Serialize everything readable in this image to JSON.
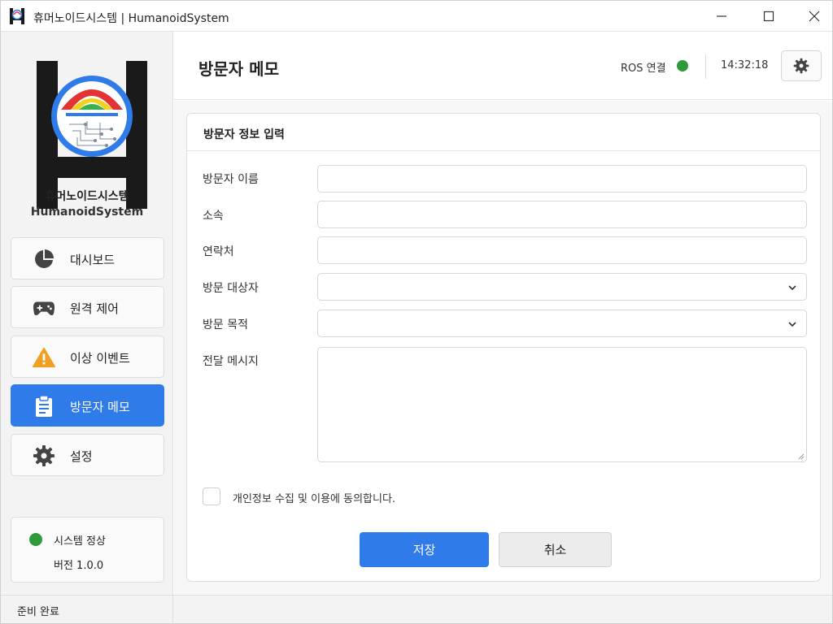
{
  "window": {
    "title": "휴머노이드시스템 | HumanoidSystem"
  },
  "sidebar": {
    "app_name_ko": "휴머노이드시스템",
    "app_name_en": "HumanoidSystem",
    "items": [
      {
        "label": "대시보드",
        "icon": "pie-chart-icon",
        "active": false
      },
      {
        "label": "원격 제어",
        "icon": "gamepad-icon",
        "active": false
      },
      {
        "label": "이상 이벤트",
        "icon": "warning-icon",
        "active": false
      },
      {
        "label": "방문자 메모",
        "icon": "clipboard-icon",
        "active": true
      },
      {
        "label": "설정",
        "icon": "gear-icon",
        "active": false
      }
    ],
    "status": {
      "text": "시스템 정상",
      "version": "버전  1.0.0",
      "color": "#2e9a3a"
    }
  },
  "header": {
    "title": "방문자 메모",
    "ros_label": "ROS 연결",
    "ros_status_color": "#2e9a3a",
    "clock": "14:32:18"
  },
  "form": {
    "title": "방문자 정보 입력",
    "fields": [
      {
        "label": "방문자 이름",
        "type": "text",
        "value": ""
      },
      {
        "label": "소속",
        "type": "text",
        "value": ""
      },
      {
        "label": "연락처",
        "type": "text",
        "value": ""
      },
      {
        "label": "방문 대상자",
        "type": "select",
        "value": ""
      },
      {
        "label": "방문 목적",
        "type": "select",
        "value": ""
      },
      {
        "label": "전달 메시지",
        "type": "textarea",
        "value": ""
      }
    ],
    "consent_label": "개인정보 수집 및 이용에 동의합니다.",
    "consent_checked": false,
    "save_label": "저장",
    "cancel_label": "취소"
  },
  "statusbar": {
    "text": "준비 완료"
  },
  "colors": {
    "accent": "#2f7bea",
    "ok": "#2e9a3a",
    "warning": "#f0a020"
  }
}
